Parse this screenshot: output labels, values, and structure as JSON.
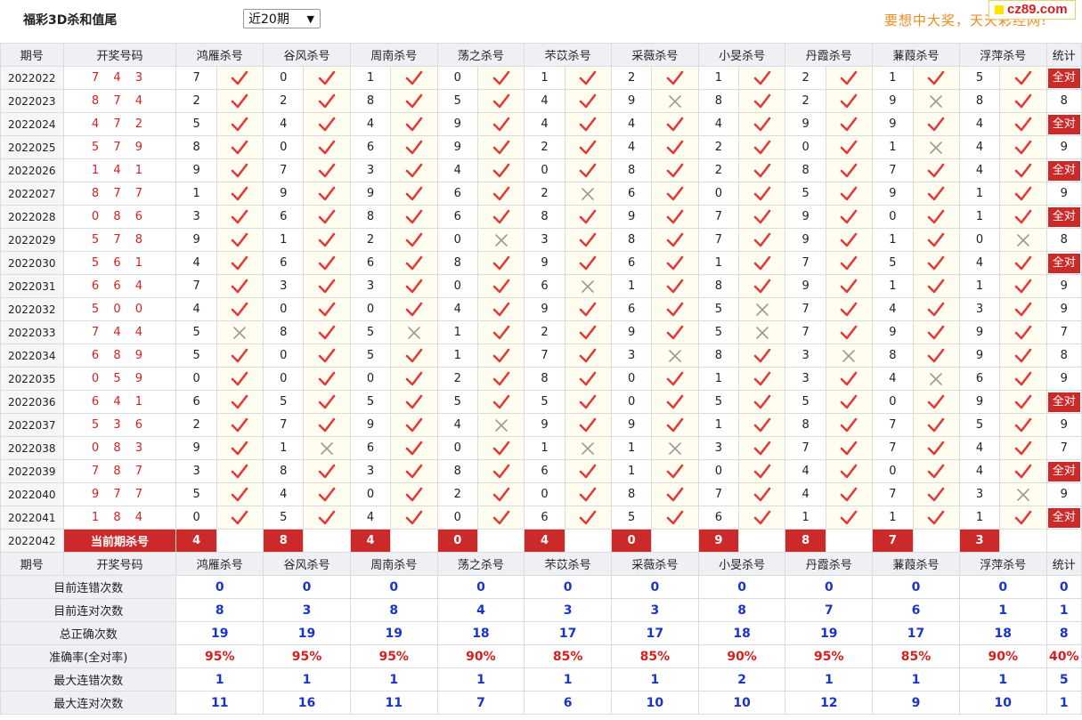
{
  "top": {
    "title": "福彩3D杀和值尾",
    "period_select": "近20期",
    "slogan": "要想中大奖，天天彩经网!",
    "logo_text": "cz89.com"
  },
  "colors": {
    "accent_red": "#cc2a2a",
    "check_red": "#e23a3a",
    "cross_gray": "#9a9a9a",
    "stat_blue": "#1a35c8"
  },
  "header": {
    "issue": "期号",
    "draw": "开奖号码",
    "experts": [
      "鸿雁杀号",
      "谷风杀号",
      "周南杀号",
      "荡之杀号",
      "芣苡杀号",
      "采薇杀号",
      "小旻杀号",
      "丹霞杀号",
      "蒹葭杀号",
      "浮萍杀号"
    ],
    "stat": "统计"
  },
  "rows": [
    {
      "issue": "2022022",
      "draw": "7 4 3",
      "cells": [
        [
          "7",
          "ok"
        ],
        [
          "0",
          "ok"
        ],
        [
          "1",
          "ok"
        ],
        [
          "0",
          "ok"
        ],
        [
          "1",
          "ok"
        ],
        [
          "2",
          "ok"
        ],
        [
          "1",
          "ok"
        ],
        [
          "2",
          "ok"
        ],
        [
          "1",
          "ok"
        ],
        [
          "5",
          "ok"
        ]
      ],
      "stat": "全对"
    },
    {
      "issue": "2022023",
      "draw": "8 7 4",
      "cells": [
        [
          "2",
          "ok"
        ],
        [
          "2",
          "ok"
        ],
        [
          "8",
          "ok"
        ],
        [
          "5",
          "ok"
        ],
        [
          "4",
          "ok"
        ],
        [
          "9",
          "x"
        ],
        [
          "8",
          "ok"
        ],
        [
          "2",
          "ok"
        ],
        [
          "9",
          "x"
        ],
        [
          "8",
          "ok"
        ]
      ],
      "stat": "8"
    },
    {
      "issue": "2022024",
      "draw": "4 7 2",
      "cells": [
        [
          "5",
          "ok"
        ],
        [
          "4",
          "ok"
        ],
        [
          "4",
          "ok"
        ],
        [
          "9",
          "ok"
        ],
        [
          "4",
          "ok"
        ],
        [
          "4",
          "ok"
        ],
        [
          "4",
          "ok"
        ],
        [
          "9",
          "ok"
        ],
        [
          "9",
          "ok"
        ],
        [
          "4",
          "ok"
        ]
      ],
      "stat": "全对"
    },
    {
      "issue": "2022025",
      "draw": "5 7 9",
      "cells": [
        [
          "8",
          "ok"
        ],
        [
          "0",
          "ok"
        ],
        [
          "6",
          "ok"
        ],
        [
          "9",
          "ok"
        ],
        [
          "2",
          "ok"
        ],
        [
          "4",
          "ok"
        ],
        [
          "2",
          "ok"
        ],
        [
          "0",
          "ok"
        ],
        [
          "1",
          "x"
        ],
        [
          "4",
          "ok"
        ]
      ],
      "stat": "9"
    },
    {
      "issue": "2022026",
      "draw": "1 4 1",
      "cells": [
        [
          "9",
          "ok"
        ],
        [
          "7",
          "ok"
        ],
        [
          "3",
          "ok"
        ],
        [
          "4",
          "ok"
        ],
        [
          "0",
          "ok"
        ],
        [
          "8",
          "ok"
        ],
        [
          "2",
          "ok"
        ],
        [
          "8",
          "ok"
        ],
        [
          "7",
          "ok"
        ],
        [
          "4",
          "ok"
        ]
      ],
      "stat": "全对"
    },
    {
      "issue": "2022027",
      "draw": "8 7 7",
      "cells": [
        [
          "1",
          "ok"
        ],
        [
          "9",
          "ok"
        ],
        [
          "9",
          "ok"
        ],
        [
          "6",
          "ok"
        ],
        [
          "2",
          "x"
        ],
        [
          "6",
          "ok"
        ],
        [
          "0",
          "ok"
        ],
        [
          "5",
          "ok"
        ],
        [
          "9",
          "ok"
        ],
        [
          "1",
          "ok"
        ]
      ],
      "stat": "9"
    },
    {
      "issue": "2022028",
      "draw": "0 8 6",
      "cells": [
        [
          "3",
          "ok"
        ],
        [
          "6",
          "ok"
        ],
        [
          "8",
          "ok"
        ],
        [
          "6",
          "ok"
        ],
        [
          "8",
          "ok"
        ],
        [
          "9",
          "ok"
        ],
        [
          "7",
          "ok"
        ],
        [
          "9",
          "ok"
        ],
        [
          "0",
          "ok"
        ],
        [
          "1",
          "ok"
        ]
      ],
      "stat": "全对"
    },
    {
      "issue": "2022029",
      "draw": "5 7 8",
      "cells": [
        [
          "9",
          "ok"
        ],
        [
          "1",
          "ok"
        ],
        [
          "2",
          "ok"
        ],
        [
          "0",
          "x"
        ],
        [
          "3",
          "ok"
        ],
        [
          "8",
          "ok"
        ],
        [
          "7",
          "ok"
        ],
        [
          "9",
          "ok"
        ],
        [
          "1",
          "ok"
        ],
        [
          "0",
          "x"
        ]
      ],
      "stat": "8"
    },
    {
      "issue": "2022030",
      "draw": "5 6 1",
      "cells": [
        [
          "4",
          "ok"
        ],
        [
          "6",
          "ok"
        ],
        [
          "6",
          "ok"
        ],
        [
          "8",
          "ok"
        ],
        [
          "9",
          "ok"
        ],
        [
          "6",
          "ok"
        ],
        [
          "1",
          "ok"
        ],
        [
          "7",
          "ok"
        ],
        [
          "5",
          "ok"
        ],
        [
          "4",
          "ok"
        ]
      ],
      "stat": "全对"
    },
    {
      "issue": "2022031",
      "draw": "6 6 4",
      "cells": [
        [
          "7",
          "ok"
        ],
        [
          "3",
          "ok"
        ],
        [
          "3",
          "ok"
        ],
        [
          "0",
          "ok"
        ],
        [
          "6",
          "x"
        ],
        [
          "1",
          "ok"
        ],
        [
          "8",
          "ok"
        ],
        [
          "9",
          "ok"
        ],
        [
          "1",
          "ok"
        ],
        [
          "1",
          "ok"
        ]
      ],
      "stat": "9"
    },
    {
      "issue": "2022032",
      "draw": "5 0 0",
      "cells": [
        [
          "4",
          "ok"
        ],
        [
          "0",
          "ok"
        ],
        [
          "0",
          "ok"
        ],
        [
          "4",
          "ok"
        ],
        [
          "9",
          "ok"
        ],
        [
          "6",
          "ok"
        ],
        [
          "5",
          "x"
        ],
        [
          "7",
          "ok"
        ],
        [
          "4",
          "ok"
        ],
        [
          "3",
          "ok"
        ]
      ],
      "stat": "9"
    },
    {
      "issue": "2022033",
      "draw": "7 4 4",
      "cells": [
        [
          "5",
          "x"
        ],
        [
          "8",
          "ok"
        ],
        [
          "5",
          "x"
        ],
        [
          "1",
          "ok"
        ],
        [
          "2",
          "ok"
        ],
        [
          "9",
          "ok"
        ],
        [
          "5",
          "x"
        ],
        [
          "7",
          "ok"
        ],
        [
          "9",
          "ok"
        ],
        [
          "9",
          "ok"
        ]
      ],
      "stat": "7"
    },
    {
      "issue": "2022034",
      "draw": "6 8 9",
      "cells": [
        [
          "5",
          "ok"
        ],
        [
          "0",
          "ok"
        ],
        [
          "5",
          "ok"
        ],
        [
          "1",
          "ok"
        ],
        [
          "7",
          "ok"
        ],
        [
          "3",
          "x"
        ],
        [
          "8",
          "ok"
        ],
        [
          "3",
          "x"
        ],
        [
          "8",
          "ok"
        ],
        [
          "9",
          "ok"
        ]
      ],
      "stat": "8"
    },
    {
      "issue": "2022035",
      "draw": "0 5 9",
      "cells": [
        [
          "0",
          "ok"
        ],
        [
          "0",
          "ok"
        ],
        [
          "0",
          "ok"
        ],
        [
          "2",
          "ok"
        ],
        [
          "8",
          "ok"
        ],
        [
          "0",
          "ok"
        ],
        [
          "1",
          "ok"
        ],
        [
          "3",
          "ok"
        ],
        [
          "4",
          "x"
        ],
        [
          "6",
          "ok"
        ]
      ],
      "stat": "9"
    },
    {
      "issue": "2022036",
      "draw": "6 4 1",
      "cells": [
        [
          "6",
          "ok"
        ],
        [
          "5",
          "ok"
        ],
        [
          "5",
          "ok"
        ],
        [
          "5",
          "ok"
        ],
        [
          "5",
          "ok"
        ],
        [
          "0",
          "ok"
        ],
        [
          "5",
          "ok"
        ],
        [
          "5",
          "ok"
        ],
        [
          "0",
          "ok"
        ],
        [
          "9",
          "ok"
        ]
      ],
      "stat": "全对"
    },
    {
      "issue": "2022037",
      "draw": "5 3 6",
      "cells": [
        [
          "2",
          "ok"
        ],
        [
          "7",
          "ok"
        ],
        [
          "9",
          "ok"
        ],
        [
          "4",
          "x"
        ],
        [
          "9",
          "ok"
        ],
        [
          "9",
          "ok"
        ],
        [
          "1",
          "ok"
        ],
        [
          "8",
          "ok"
        ],
        [
          "7",
          "ok"
        ],
        [
          "5",
          "ok"
        ]
      ],
      "stat": "9"
    },
    {
      "issue": "2022038",
      "draw": "0 8 3",
      "cells": [
        [
          "9",
          "ok"
        ],
        [
          "1",
          "x"
        ],
        [
          "6",
          "ok"
        ],
        [
          "0",
          "ok"
        ],
        [
          "1",
          "x"
        ],
        [
          "1",
          "x"
        ],
        [
          "3",
          "ok"
        ],
        [
          "7",
          "ok"
        ],
        [
          "7",
          "ok"
        ],
        [
          "4",
          "ok"
        ]
      ],
      "stat": "7"
    },
    {
      "issue": "2022039",
      "draw": "7 8 7",
      "cells": [
        [
          "3",
          "ok"
        ],
        [
          "8",
          "ok"
        ],
        [
          "3",
          "ok"
        ],
        [
          "8",
          "ok"
        ],
        [
          "6",
          "ok"
        ],
        [
          "1",
          "ok"
        ],
        [
          "0",
          "ok"
        ],
        [
          "4",
          "ok"
        ],
        [
          "0",
          "ok"
        ],
        [
          "4",
          "ok"
        ]
      ],
      "stat": "全对"
    },
    {
      "issue": "2022040",
      "draw": "9 7 7",
      "cells": [
        [
          "5",
          "ok"
        ],
        [
          "4",
          "ok"
        ],
        [
          "0",
          "ok"
        ],
        [
          "2",
          "ok"
        ],
        [
          "0",
          "ok"
        ],
        [
          "8",
          "ok"
        ],
        [
          "7",
          "ok"
        ],
        [
          "4",
          "ok"
        ],
        [
          "7",
          "ok"
        ],
        [
          "3",
          "x"
        ]
      ],
      "stat": "9"
    },
    {
      "issue": "2022041",
      "draw": "1 8 4",
      "cells": [
        [
          "0",
          "ok"
        ],
        [
          "5",
          "ok"
        ],
        [
          "4",
          "ok"
        ],
        [
          "0",
          "ok"
        ],
        [
          "6",
          "ok"
        ],
        [
          "5",
          "ok"
        ],
        [
          "6",
          "ok"
        ],
        [
          "1",
          "ok"
        ],
        [
          "1",
          "ok"
        ],
        [
          "1",
          "ok"
        ]
      ],
      "stat": "全对"
    }
  ],
  "current": {
    "issue": "2022042",
    "label": "当前期杀号",
    "values": [
      "4",
      "8",
      "4",
      "0",
      "4",
      "0",
      "9",
      "8",
      "7",
      "3"
    ]
  },
  "summary": [
    {
      "label": "目前连错次数",
      "values": [
        "0",
        "0",
        "0",
        "0",
        "0",
        "0",
        "0",
        "0",
        "0",
        "0"
      ],
      "stat": "0",
      "pct": false
    },
    {
      "label": "目前连对次数",
      "values": [
        "8",
        "3",
        "8",
        "4",
        "3",
        "3",
        "8",
        "7",
        "6",
        "1"
      ],
      "stat": "1",
      "pct": false
    },
    {
      "label": "总正确次数",
      "values": [
        "19",
        "19",
        "19",
        "18",
        "17",
        "17",
        "18",
        "19",
        "17",
        "18"
      ],
      "stat": "8",
      "pct": false
    },
    {
      "label": "准确率(全对率)",
      "values": [
        "95%",
        "95%",
        "95%",
        "90%",
        "85%",
        "85%",
        "90%",
        "95%",
        "85%",
        "90%"
      ],
      "stat": "40%",
      "pct": true
    },
    {
      "label": "最大连错次数",
      "values": [
        "1",
        "1",
        "1",
        "1",
        "1",
        "1",
        "2",
        "1",
        "1",
        "1"
      ],
      "stat": "5",
      "pct": false
    },
    {
      "label": "最大连对次数",
      "values": [
        "11",
        "16",
        "11",
        "7",
        "6",
        "10",
        "10",
        "12",
        "9",
        "10"
      ],
      "stat": "1",
      "pct": false
    }
  ]
}
